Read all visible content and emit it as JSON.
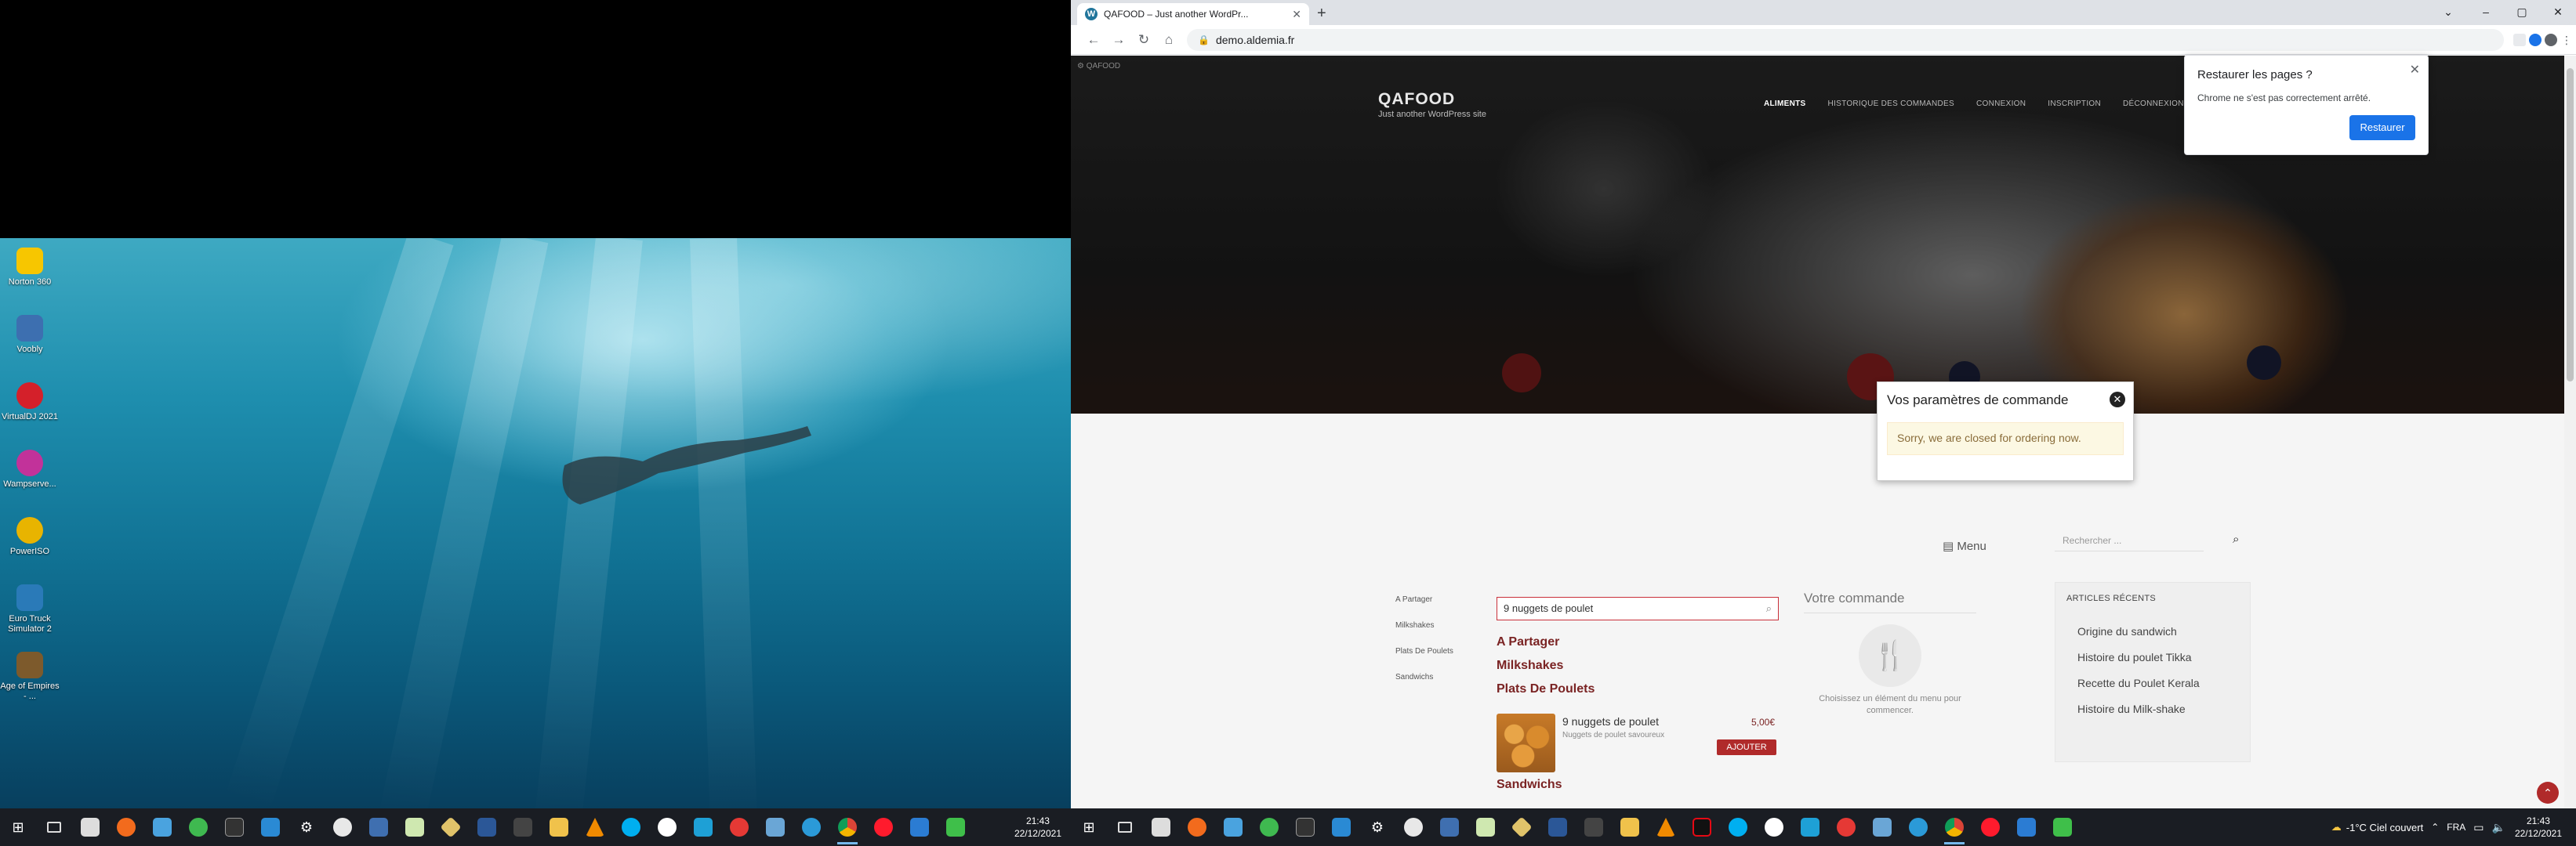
{
  "desktop": {
    "icons": [
      {
        "label": "Norton 360",
        "color": "#f7c600"
      },
      {
        "label": "Voobly",
        "color": "#3d6fb0"
      },
      {
        "label": "VirtualDJ 2021",
        "color": "#d4202a"
      },
      {
        "label": "Wampserve...",
        "color": "#c2329a"
      },
      {
        "label": "PowerISO",
        "color": "#e8b400"
      },
      {
        "label": "Euro Truck Simulator 2",
        "color": "#2a7ab8"
      },
      {
        "label": "Age of Empires - ...",
        "color": "#7d5a2c"
      }
    ]
  },
  "left_taskbar": {
    "clock_time": "21:43",
    "clock_date": "22/12/2021"
  },
  "browser": {
    "tab_title": "QAFOOD – Just another WordPr...",
    "tab_favicon": "W",
    "url": "demo.aldemia.fr",
    "window_controls": {
      "minimize": "–",
      "maximize": "▢",
      "close": "✕"
    },
    "new_tab": "+"
  },
  "site": {
    "title": "QAFOOD",
    "tagline": "Just another WordPress site",
    "admin_mini": "QAFOOD",
    "nav": [
      "ALIMENTS",
      "HISTORIQUE DES COMMANDES",
      "CONNEXION",
      "INSCRIPTION",
      "DÉCONNEXION"
    ],
    "sidebar_categories": [
      "A Partager",
      "Milkshakes",
      "Plats De Poulets",
      "Sandwichs"
    ],
    "search_value": "9 nuggets de poulet",
    "categories": [
      "A Partager",
      "Milkshakes",
      "Plats De Poulets",
      "Sandwichs"
    ],
    "item": {
      "name": "9 nuggets de poulet",
      "description": "Nuggets de poulet savoureux",
      "price": "5,00€",
      "add_label": "AJOUTER"
    },
    "order": {
      "title": "Votre commande",
      "hint": "Choisissez un élément du menu pour commencer."
    },
    "menu_label": "Menu",
    "widget_search_placeholder": "Rechercher ...",
    "recent": {
      "title": "ARTICLES RÉCENTS",
      "items": [
        "Origine du sandwich",
        "Histoire du poulet Tikka",
        "Recette du Poulet Kerala",
        "Histoire du Milk-shake"
      ]
    }
  },
  "modal": {
    "title": "Vos paramètres de commande",
    "alert": "Sorry, we are closed for ordering now."
  },
  "restore": {
    "title": "Restaurer les pages ?",
    "message": "Chrome ne s'est pas correctement arrêté.",
    "button": "Restaurer"
  },
  "right_taskbar": {
    "weather": "-1°C  Ciel couvert",
    "lang": "FRA",
    "clock_time": "21:43",
    "clock_date": "22/12/2021"
  }
}
